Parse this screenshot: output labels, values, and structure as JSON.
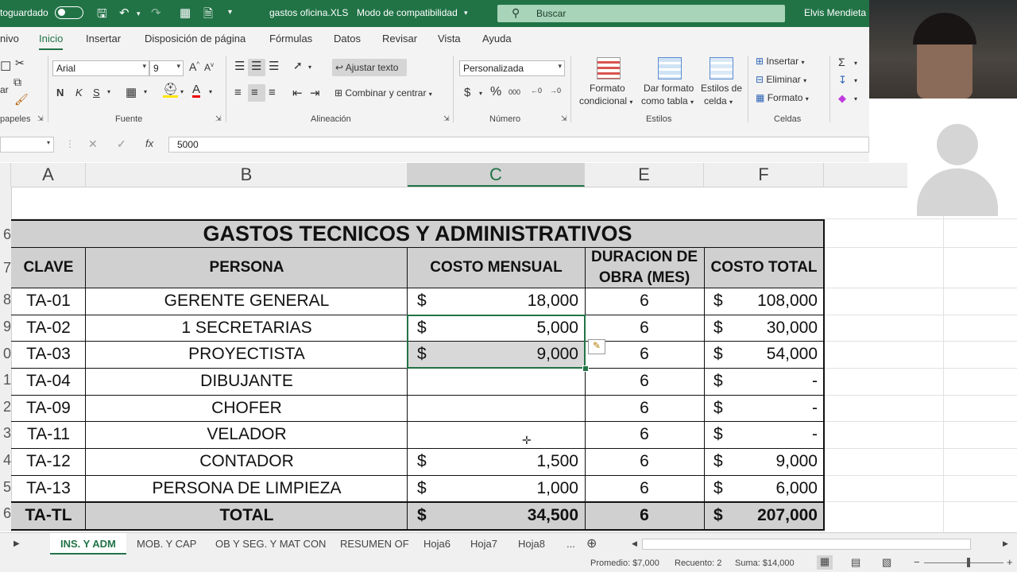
{
  "titlebar": {
    "autosave": "toguardado",
    "filename": "gastos oficina.XLS",
    "mode": "Modo de compatibilidad",
    "search_placeholder": "Buscar",
    "user": "Elvis Mendieta"
  },
  "menu": [
    "nivo",
    "Inicio",
    "Insertar",
    "Disposición de página",
    "Fórmulas",
    "Datos",
    "Revisar",
    "Vista",
    "Ayuda"
  ],
  "ribbon": {
    "clipboard_group": "papeles",
    "clipboard_paste": "ar",
    "font_name": "Arial",
    "font_size": "9",
    "font_group": "Fuente",
    "bold": "N",
    "italic": "K",
    "underline": "S",
    "wrap_text": "Ajustar texto",
    "merge_center": "Combinar y centrar",
    "alignment_group": "Alineación",
    "number_format": "Personalizada",
    "number_group": "Número",
    "cond_format": [
      "Formato",
      "condicional"
    ],
    "format_table": [
      "Dar formato",
      "como tabla"
    ],
    "cell_styles": [
      "Estilos de",
      "celda"
    ],
    "styles_group": "Estilos",
    "insert": "Insertar",
    "delete": "Eliminar",
    "format": "Formato",
    "cells_group": "Celdas"
  },
  "formula_bar": {
    "fx": "fx",
    "value": "5000"
  },
  "columns": [
    "A",
    "B",
    "C",
    "E",
    "F"
  ],
  "row_numbers": [
    "",
    "6",
    "7",
    "8",
    "9",
    "0",
    "1",
    "2",
    "3",
    "4",
    "5",
    "6"
  ],
  "sheet": {
    "title": "GASTOS TECNICOS Y ADMINISTRATIVOS",
    "headers": {
      "clave": "CLAVE",
      "persona": "PERSONA",
      "costo_mensual": "COSTO MENSUAL",
      "duracion_1": "DURACION DE",
      "duracion_2": "OBRA (MES)",
      "costo_total": "COSTO TOTAL"
    },
    "rows": [
      {
        "clave": "TA-01",
        "persona": "GERENTE GENERAL",
        "cm_sym": "$",
        "cm": "18,000",
        "dur": "6",
        "ct_sym": "$",
        "ct": "108,000"
      },
      {
        "clave": "TA-02",
        "persona": "1 SECRETARIAS",
        "cm_sym": "$",
        "cm": "5,000",
        "dur": "6",
        "ct_sym": "$",
        "ct": "30,000"
      },
      {
        "clave": "TA-03",
        "persona": "PROYECTISTA",
        "cm_sym": "$",
        "cm": "9,000",
        "dur": "6",
        "ct_sym": "$",
        "ct": "54,000"
      },
      {
        "clave": "TA-04",
        "persona": "DIBUJANTE",
        "cm_sym": "",
        "cm": "",
        "dur": "6",
        "ct_sym": "$",
        "ct": "-"
      },
      {
        "clave": "TA-09",
        "persona": "CHOFER",
        "cm_sym": "",
        "cm": "",
        "dur": "6",
        "ct_sym": "$",
        "ct": "-"
      },
      {
        "clave": "TA-11",
        "persona": "VELADOR",
        "cm_sym": "",
        "cm": "",
        "dur": "6",
        "ct_sym": "$",
        "ct": "-"
      },
      {
        "clave": "TA-12",
        "persona": "CONTADOR",
        "cm_sym": "$",
        "cm": "1,500",
        "dur": "6",
        "ct_sym": "$",
        "ct": "9,000"
      },
      {
        "clave": "TA-13",
        "persona": "PERSONA DE LIMPIEZA",
        "cm_sym": "$",
        "cm": "1,000",
        "dur": "6",
        "ct_sym": "$",
        "ct": "6,000"
      }
    ],
    "total": {
      "clave": "TA-TL",
      "persona": "TOTAL",
      "cm_sym": "$",
      "cm": "34,500",
      "dur": "6",
      "ct_sym": "$",
      "ct": "207,000"
    }
  },
  "tabs": [
    "INS. Y ADM",
    "MOB. Y CAP",
    "OB Y SEG. Y MAT CON",
    "RESUMEN OF",
    "Hoja6",
    "Hoja7",
    "Hoja8",
    "..."
  ],
  "status": {
    "average": "Promedio: $7,000",
    "count": "Recuento: 2",
    "sum": "Suma: $14,000"
  },
  "colors": {
    "accent": "#217346",
    "header_fill": "#d0d0d0"
  }
}
